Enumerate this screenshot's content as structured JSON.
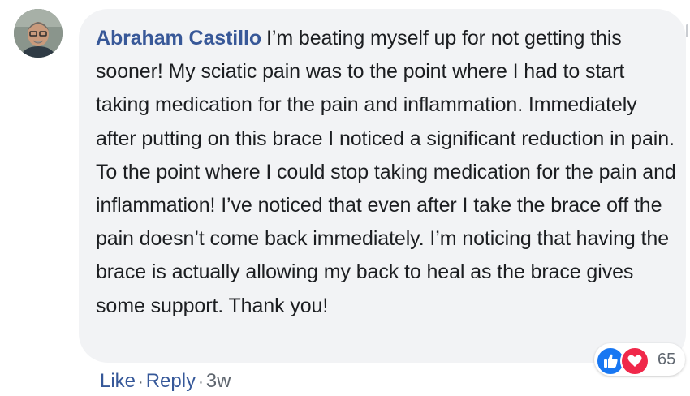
{
  "comment": {
    "author": "Abraham Castillo",
    "text": "I’m beating myself up for not getting this sooner! My sciatic pain was to the point where I had to start taking medication for the pain and inflammation. Immediately after putting on this brace I noticed a significant reduction in pain. To the point where I could stop taking medication for the pain and inflammation! I’ve noticed that even after I take the brace off the pain doesn’t come back immediately. I’m noticing that having the brace is actually allowing my back to heal as the brace gives some support. Thank you!",
    "reactions": {
      "count": "65",
      "types": [
        "like-icon",
        "love-icon"
      ]
    },
    "actions": {
      "like_label": "Like",
      "reply_label": "Reply",
      "separator": "·",
      "timestamp": "3w"
    }
  },
  "colors": {
    "author": "#385898",
    "bubble": "#f2f3f5",
    "like": "#1877f2",
    "love": "#f0284a",
    "text": "#1c1e21",
    "meta": "#606770"
  }
}
